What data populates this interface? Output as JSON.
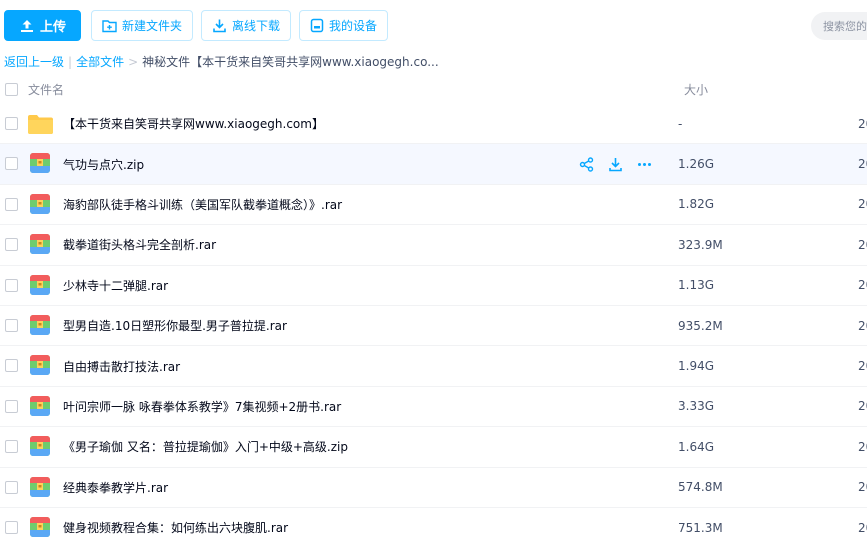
{
  "toolbar": {
    "upload": "上传",
    "new_folder": "新建文件夹",
    "offline_download": "离线下载",
    "my_devices": "我的设备",
    "search_placeholder": "搜索您的"
  },
  "breadcrumb": {
    "back": "返回上一级",
    "all_files": "全部文件",
    "current": "神秘文件【本干货来自笑哥共享网www.xiaogegh.co..."
  },
  "columns": {
    "name": "文件名",
    "size": "大小",
    "date": "20"
  },
  "files": [
    {
      "name": "【本干货来自笑哥共享网www.xiaogegh.com】",
      "size": "-",
      "date": "20",
      "type": "folder"
    },
    {
      "name": "气功与点穴.zip",
      "size": "1.26G",
      "date": "20",
      "type": "archive"
    },
    {
      "name": "海豹部队徒手格斗训练（美国军队截拳道概念）》.rar",
      "size": "1.82G",
      "date": "20",
      "type": "archive"
    },
    {
      "name": "截拳道街头格斗完全剖析.rar",
      "size": "323.9M",
      "date": "20",
      "type": "archive"
    },
    {
      "name": "少林寺十二弹腿.rar",
      "size": "1.13G",
      "date": "20",
      "type": "archive"
    },
    {
      "name": "型男自造.10日塑形你最型.男子普拉提.rar",
      "size": "935.2M",
      "date": "20",
      "type": "archive"
    },
    {
      "name": "自由搏击散打技法.rar",
      "size": "1.94G",
      "date": "20",
      "type": "archive"
    },
    {
      "name": "叶问宗师一脉 咏春拳体系教学》7集视频+2册书.rar",
      "size": "3.33G",
      "date": "20",
      "type": "archive"
    },
    {
      "name": "《男子瑜伽 又名：普拉提瑜伽》入门+中级+高级.zip",
      "size": "1.64G",
      "date": "20",
      "type": "archive"
    },
    {
      "name": "经典泰拳教学片.rar",
      "size": "574.8M",
      "date": "20",
      "type": "archive"
    },
    {
      "name": "健身视频教程合集：如何练出六块腹肌.rar",
      "size": "751.3M",
      "date": "20",
      "type": "archive"
    }
  ],
  "colors": {
    "accent": "#06a7ff",
    "hover_row": "#f5f8ff",
    "folder": "#ffc94a"
  },
  "icons": [
    "upload-icon",
    "new-folder-icon",
    "download-icon",
    "device-icon",
    "share-icon",
    "more-icon",
    "folder-icon",
    "archive-icon"
  ]
}
